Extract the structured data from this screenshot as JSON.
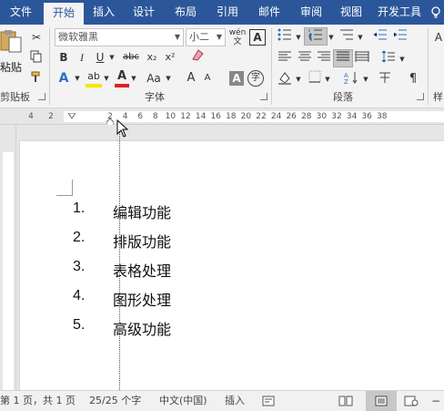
{
  "tabs": [
    {
      "label": "文件",
      "active": false
    },
    {
      "label": "开始",
      "active": true
    },
    {
      "label": "插入",
      "active": false
    },
    {
      "label": "设计",
      "active": false
    },
    {
      "label": "布局",
      "active": false
    },
    {
      "label": "引用",
      "active": false
    },
    {
      "label": "邮件",
      "active": false
    },
    {
      "label": "审阅",
      "active": false
    },
    {
      "label": "视图",
      "active": false
    },
    {
      "label": "开发工具",
      "active": false
    }
  ],
  "ribbon": {
    "clipboard": {
      "paste_label": "粘贴",
      "group_label": "剪贴板"
    },
    "font": {
      "font_name": "微软雅黑",
      "font_size": "小二",
      "wen_glyph": "wén",
      "wen_glyph2": "文",
      "a_box": "A",
      "bold": "B",
      "italic": "I",
      "underline": "U",
      "strike": "abc",
      "subscript": "x₂",
      "superscript": "x²",
      "text_effect": "A",
      "highlight": "ab",
      "font_color": "A",
      "change_case": "Aa",
      "grow": "A",
      "shrink": "A",
      "char_shading": "A",
      "enclose": "字",
      "group_label": "字体"
    },
    "paragraph": {
      "group_label": "段落"
    },
    "styles": {
      "group_label": "样"
    }
  },
  "ruler": {
    "left_numbers": [
      "4",
      "2"
    ],
    "right_numbers": [
      "2",
      "4",
      "6",
      "8",
      "10",
      "12",
      "14",
      "16",
      "18",
      "20",
      "22",
      "24",
      "26",
      "28",
      "30",
      "32",
      "34",
      "36",
      "38"
    ]
  },
  "document": {
    "list": [
      {
        "num": "1.",
        "text": "编辑功能"
      },
      {
        "num": "2.",
        "text": "排版功能"
      },
      {
        "num": "3.",
        "text": "表格处理"
      },
      {
        "num": "4.",
        "text": "图形处理"
      },
      {
        "num": "5.",
        "text": "高级功能"
      }
    ]
  },
  "status": {
    "page": "第 1 页，共 1 页",
    "words": "25/25 个字",
    "language": "中文(中国)",
    "mode": "插入"
  },
  "colors": {
    "tab_bar": "#2b579a",
    "ribbon": "#f3f3f3",
    "doc_bg": "#e6e6e6"
  }
}
